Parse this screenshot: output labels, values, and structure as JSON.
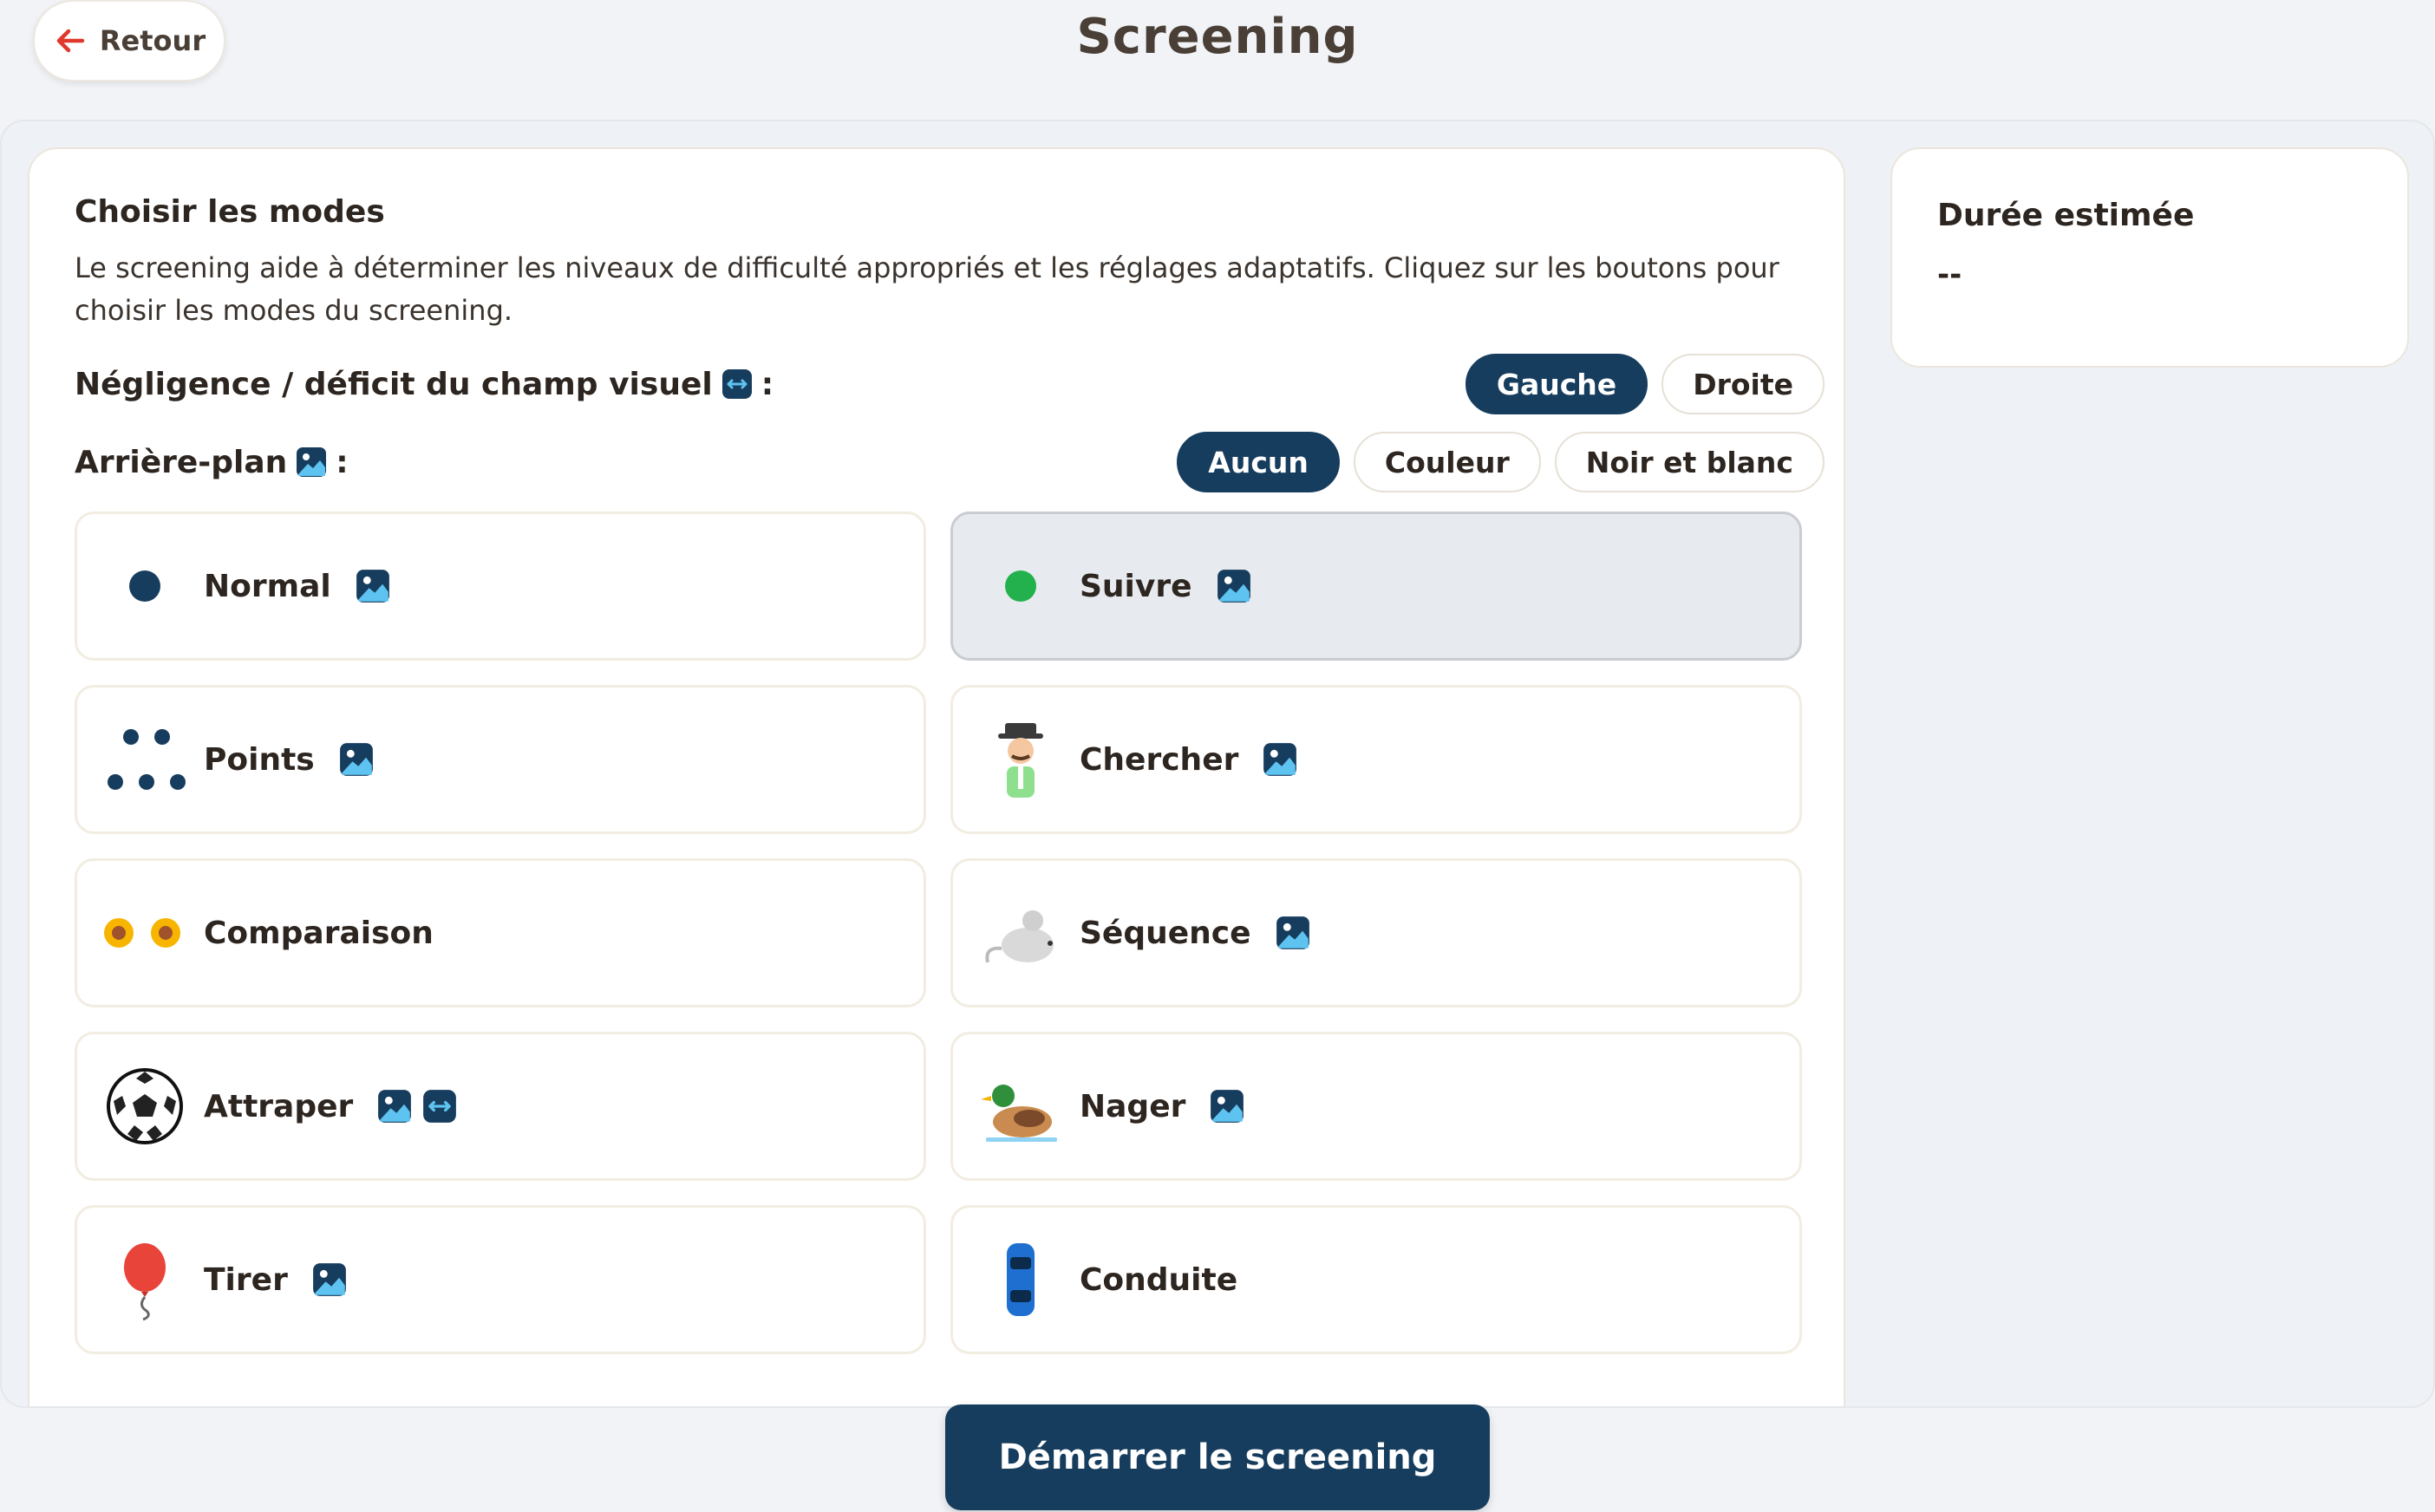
{
  "header": {
    "back_label": "Retour",
    "title": "Screening"
  },
  "modes_section": {
    "title": "Choisir les modes",
    "description": "Le screening aide à déterminer les niveaux de difficulté appropriés et les réglages adaptatifs. Cliquez sur les boutons pour choisir les modes du screening."
  },
  "neglect": {
    "label": "Négligence / déficit du champ visuel",
    "suffix": ":",
    "options": [
      "Gauche",
      "Droite"
    ],
    "selected": "Gauche"
  },
  "background": {
    "label": "Arrière-plan",
    "suffix": ":",
    "options": [
      "Aucun",
      "Couleur",
      "Noir et blanc"
    ],
    "selected": "Aucun"
  },
  "modes": [
    {
      "label": "Normal",
      "icon": "dark-dot-icon",
      "tags": [
        "image-icon"
      ]
    },
    {
      "label": "Suivre",
      "icon": "green-dot-icon",
      "tags": [
        "image-icon"
      ],
      "selected": true
    },
    {
      "label": "Points",
      "icon": "dots-icon",
      "tags": [
        "image-icon"
      ]
    },
    {
      "label": "Chercher",
      "icon": "detective-icon",
      "tags": [
        "image-icon"
      ]
    },
    {
      "label": "Comparaison",
      "icon": "sunflowers-icon",
      "tags": []
    },
    {
      "label": "Séquence",
      "icon": "mouse-icon",
      "tags": [
        "image-icon"
      ]
    },
    {
      "label": "Attraper",
      "icon": "soccer-ball-icon",
      "tags": [
        "image-icon",
        "arrows-icon"
      ]
    },
    {
      "label": "Nager",
      "icon": "duck-icon",
      "tags": [
        "image-icon"
      ]
    },
    {
      "label": "Tirer",
      "icon": "balloon-icon",
      "tags": [
        "image-icon"
      ]
    },
    {
      "label": "Conduite",
      "icon": "car-icon",
      "tags": []
    }
  ],
  "duration": {
    "title": "Durée estimée",
    "value": "--"
  },
  "start_label": "Démarrer le screening",
  "colors": {
    "primary": "#173d5e",
    "accent_green": "#22b14c",
    "back_arrow": "#e0382b"
  }
}
